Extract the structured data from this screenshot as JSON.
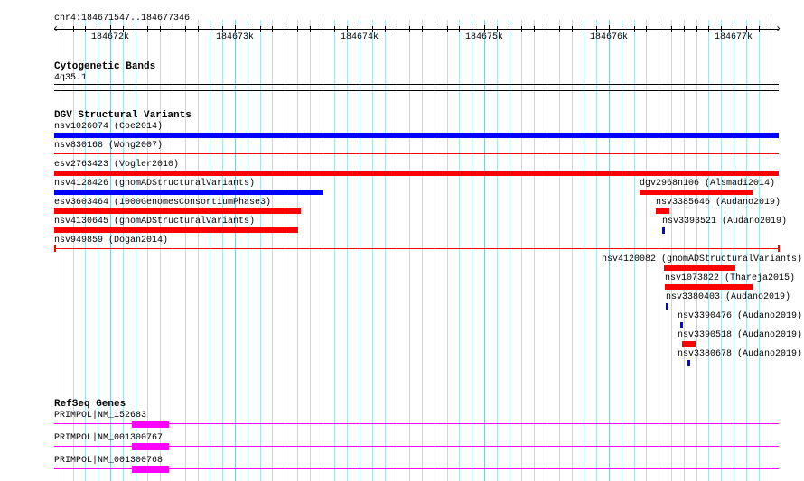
{
  "ruler": {
    "location": "chr4:184671547..184677346",
    "labels": [
      "184672k",
      "184673k",
      "184674k",
      "184675k",
      "184676k",
      "184677k"
    ]
  },
  "tracks": {
    "cyto": {
      "title": "Cytogenetic Bands",
      "band": "4q35.1"
    },
    "dgv": {
      "title": "DGV Structural Variants",
      "features": [
        {
          "label": "nsv1026074 (Coe2014)",
          "color": "#0000ff"
        },
        {
          "label": "nsv830168 (Wong2007)",
          "color": "#ff0000"
        },
        {
          "label": "esv2763423 (Vogler2010)",
          "color": "#ff0000"
        },
        {
          "label": "nsv4128426 (gnomADStructuralVariants)",
          "color": "#0000ff"
        },
        {
          "label": "esv3603464 (1000GenomesConsortiumPhase3)",
          "color": "#ff0000"
        },
        {
          "label": "nsv4130645 (gnomADStructuralVariants)",
          "color": "#ff0000"
        },
        {
          "label": "nsv949859 (Dogan2014)",
          "color": "#ff0000"
        },
        {
          "label": "dgv2968n106 (Alsmadi2014)",
          "color": "#ff0000"
        },
        {
          "label": "nsv3385646 (Audano2019)",
          "color": "#ff0000"
        },
        {
          "label": "nsv3393521 (Audano2019)",
          "color": "#0000ff"
        },
        {
          "label": "nsv4120082 (gnomADStructuralVariants)",
          "color": "#ff0000"
        },
        {
          "label": "nsv1073822 (Thareja2015)",
          "color": "#ff0000"
        },
        {
          "label": "nsv3380403 (Audano2019)",
          "color": "#0000ff"
        },
        {
          "label": "nsv3390476 (Audano2019)",
          "color": "#0000ff"
        },
        {
          "label": "nsv3390518 (Audano2019)",
          "color": "#ff0000"
        },
        {
          "label": "nsv3380678 (Audano2019)",
          "color": "#0000ff"
        }
      ]
    },
    "refseq": {
      "title": "RefSeq Genes",
      "color": "#ff00ff",
      "genes": [
        {
          "label": "PRIMPOL|NM_152683"
        },
        {
          "label": "PRIMPOL|NM_001300767"
        },
        {
          "label": "PRIMPOL|NM_001300768"
        }
      ]
    }
  }
}
